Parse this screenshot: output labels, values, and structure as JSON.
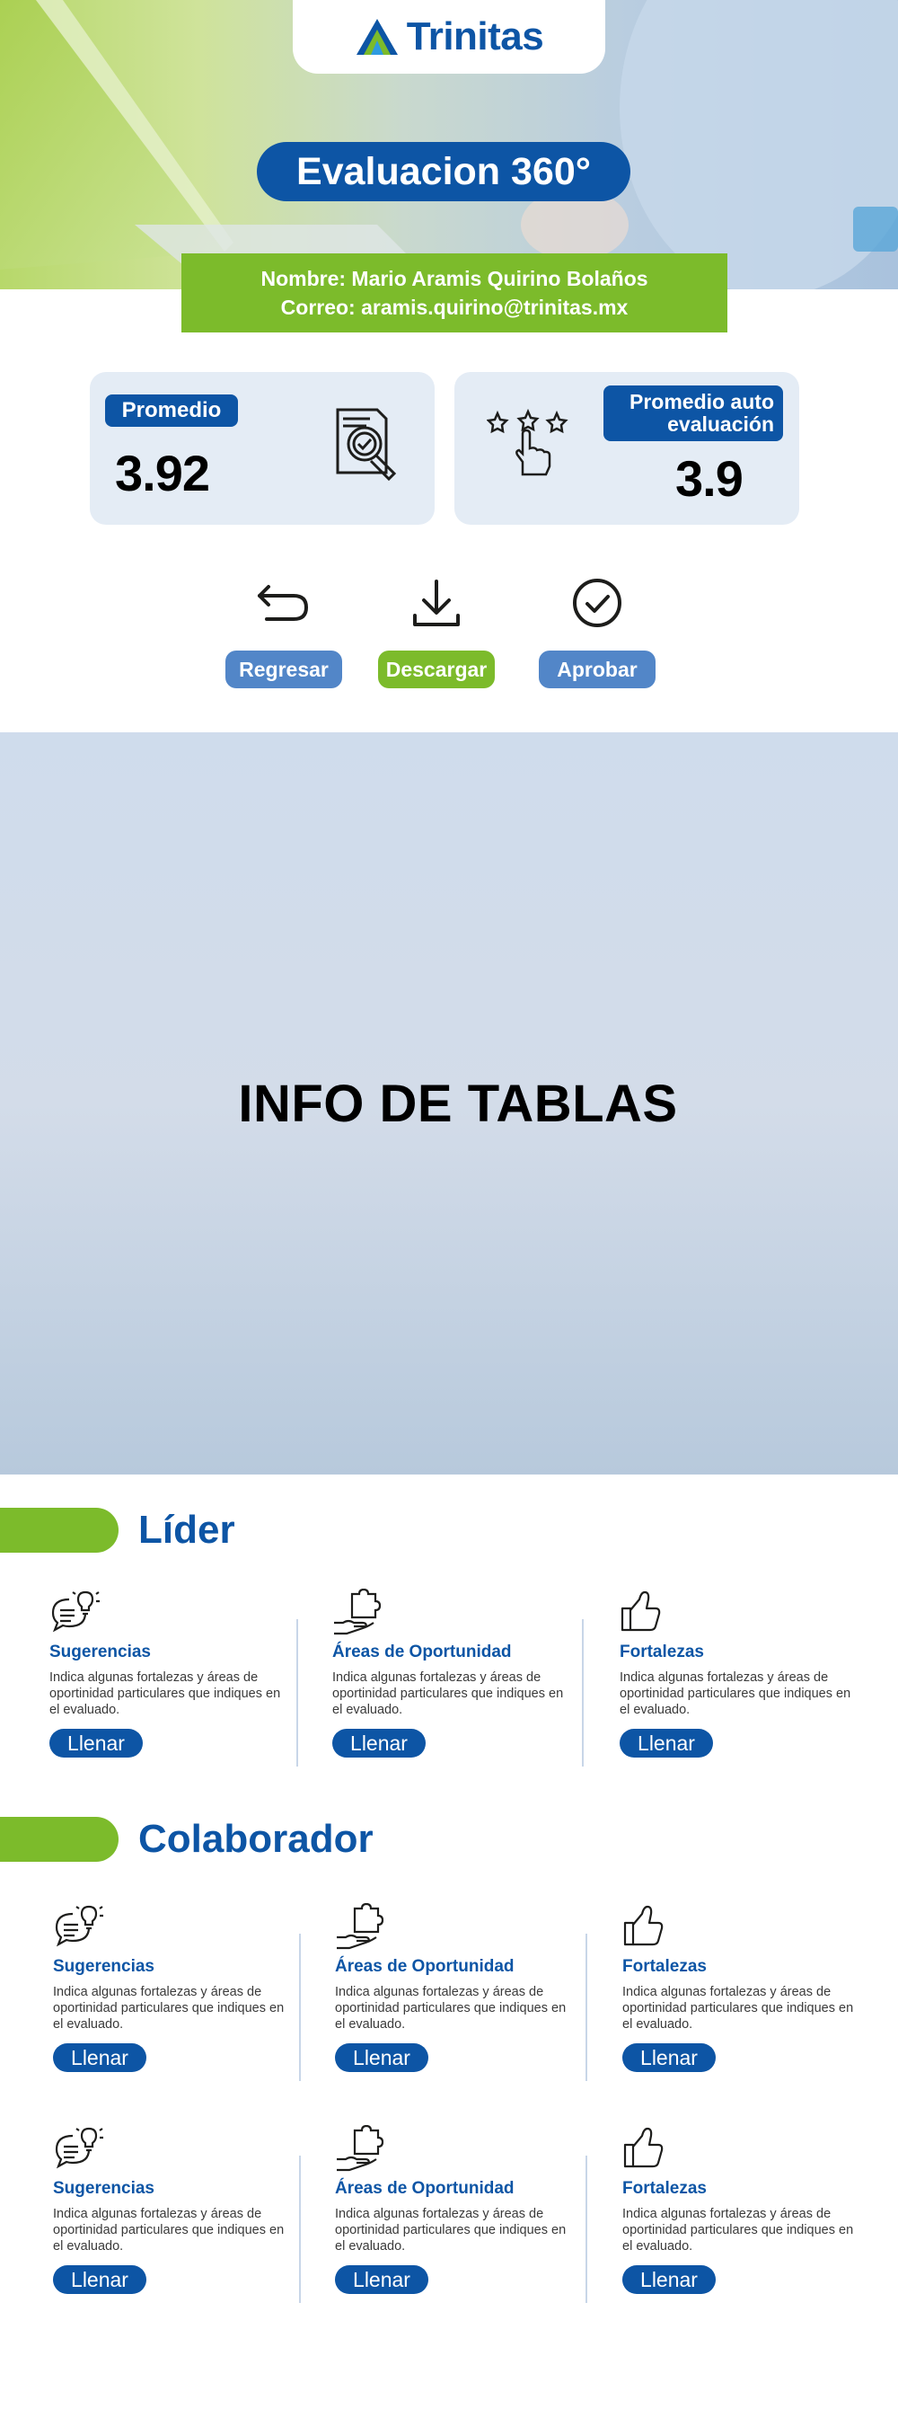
{
  "brand": {
    "name": "Trinitas"
  },
  "title": "Evaluacion 360°",
  "employee": {
    "name_line": "Nombre: Mario Aramis Quirino Bolaños",
    "email_line": "Correo: aramis.quirino@trinitas.mx"
  },
  "stats": {
    "promedio_label": "Promedio",
    "promedio_value": "3.92",
    "auto_label_line1": "Promedio auto",
    "auto_label_line2": "evaluación",
    "auto_value": "3.9"
  },
  "actions": {
    "regresar": "Regresar",
    "descargar": "Descargar",
    "aprobar": "Aprobar"
  },
  "info_panel": "INFO DE TABLAS",
  "sections": [
    {
      "title": "Líder",
      "rows": [
        [
          {
            "icon": "lightbulb-chat-icon",
            "title": "Sugerencias",
            "desc": "Indica algunas fortalezas y áreas de oportinidad particulares que indiques en el evaluado.",
            "button": "Llenar"
          },
          {
            "icon": "puzzle-hand-icon",
            "title": "Áreas de Oportunidad",
            "desc": "Indica algunas fortalezas y áreas de oportinidad particulares que indiques en el evaluado.",
            "button": "Llenar"
          },
          {
            "icon": "thumbs-up-icon",
            "title": "Fortalezas",
            "desc": "Indica algunas fortalezas y áreas de oportinidad particulares que indiques en el evaluado.",
            "button": "Llenar"
          }
        ]
      ]
    },
    {
      "title": "Colaborador",
      "rows": [
        [
          {
            "icon": "lightbulb-chat-icon",
            "title": "Sugerencias",
            "desc": "Indica algunas fortalezas y áreas de oportinidad particulares que indiques en el evaluado.",
            "button": "Llenar"
          },
          {
            "icon": "puzzle-hand-icon",
            "title": "Áreas de Oportunidad",
            "desc": "Indica algunas fortalezas y áreas de oportinidad particulares que indiques en el evaluado.",
            "button": "Llenar"
          },
          {
            "icon": "thumbs-up-icon",
            "title": "Fortalezas",
            "desc": "Indica algunas fortalezas y áreas de oportinidad particulares que indiques en el evaluado.",
            "button": "Llenar"
          }
        ],
        [
          {
            "icon": "lightbulb-chat-icon",
            "title": "Sugerencias",
            "desc": "Indica algunas fortalezas y áreas de oportinidad particulares que indiques en el evaluado.",
            "button": "Llenar"
          },
          {
            "icon": "puzzle-hand-icon",
            "title": "Áreas de Oportunidad",
            "desc": "Indica algunas fortalezas y áreas de oportinidad particulares que indiques en el evaluado.",
            "button": "Llenar"
          },
          {
            "icon": "thumbs-up-icon",
            "title": "Fortalezas",
            "desc": "Indica algunas fortalezas y áreas de oportinidad particulares que indiques en el evaluado.",
            "button": "Llenar"
          }
        ]
      ]
    }
  ],
  "colors": {
    "brand_blue": "#0d55a5",
    "brand_green": "#7cbb2b",
    "button_blue": "#5286c8",
    "card_bg": "#e4ecf5"
  }
}
